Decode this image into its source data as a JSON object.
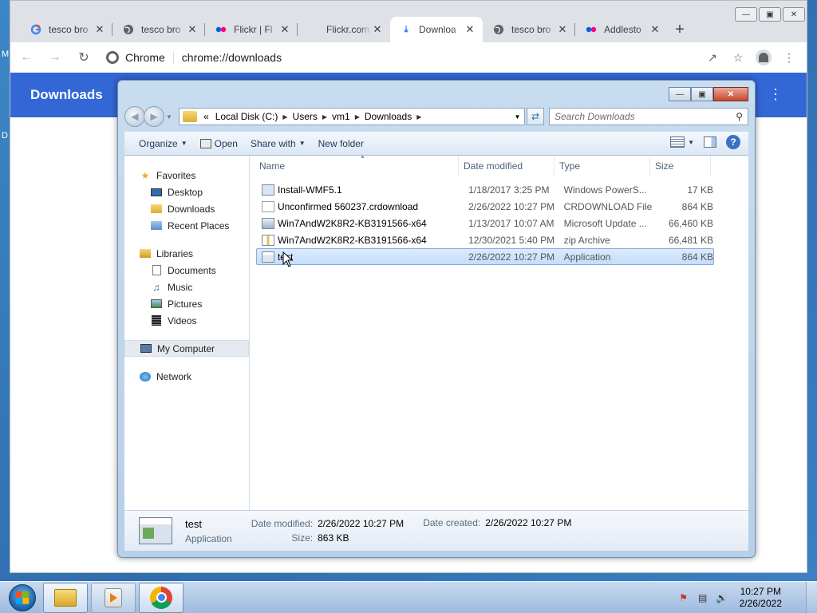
{
  "desktop": {
    "edge_texts": [
      "M",
      "D"
    ]
  },
  "browser": {
    "tabs": [
      {
        "label": "tesco bro",
        "favicon": "google-icon",
        "active": false
      },
      {
        "label": "tesco bro",
        "favicon": "globe-icon",
        "active": false
      },
      {
        "label": "Flickr | Fl",
        "favicon": "flickr-icon",
        "active": false
      },
      {
        "label": "Flickr.com",
        "favicon": "none",
        "active": false
      },
      {
        "label": "Downloa",
        "favicon": "download-icon",
        "active": true
      },
      {
        "label": "tesco bro",
        "favicon": "globe-icon",
        "active": false
      },
      {
        "label": "Addlesto",
        "favicon": "flickr-icon",
        "active": false
      }
    ],
    "omnibox": {
      "site": "Chrome",
      "url": "chrome://downloads"
    },
    "page_title": "Downloads",
    "colors": {
      "header": "#3367d6"
    }
  },
  "explorer": {
    "breadcrumb": [
      "Local Disk (C:)",
      "Users",
      "vm1",
      "Downloads"
    ],
    "breadcrumb_prefix": "«",
    "search_placeholder": "Search Downloads",
    "commands": {
      "organize": "Organize",
      "open": "Open",
      "share_with": "Share with",
      "new_folder": "New folder"
    },
    "nav": {
      "favorites": {
        "label": "Favorites",
        "items": [
          "Desktop",
          "Downloads",
          "Recent Places"
        ]
      },
      "libraries": {
        "label": "Libraries",
        "items": [
          "Documents",
          "Music",
          "Pictures",
          "Videos"
        ]
      },
      "computer": "My Computer",
      "network": "Network"
    },
    "columns": {
      "name": "Name",
      "date": "Date modified",
      "type": "Type",
      "size": "Size"
    },
    "files": [
      {
        "name": "Install-WMF5.1",
        "date": "1/18/2017 3:25 PM",
        "type": "Windows PowerS...",
        "size": "17 KB",
        "icon": "powershell-script-icon"
      },
      {
        "name": "Unconfirmed 560237.crdownload",
        "date": "2/26/2022 10:27 PM",
        "type": "CRDOWNLOAD File",
        "size": "864 KB",
        "icon": "blank-file-icon"
      },
      {
        "name": "Win7AndW2K8R2-KB3191566-x64",
        "date": "1/13/2017 10:07 AM",
        "type": "Microsoft Update ...",
        "size": "66,460 KB",
        "icon": "msu-package-icon"
      },
      {
        "name": "Win7AndW2K8R2-KB3191566-x64",
        "date": "12/30/2021 5:40 PM",
        "type": "zip Archive",
        "size": "66,481 KB",
        "icon": "zip-archive-icon"
      },
      {
        "name": "test",
        "date": "2/26/2022 10:27 PM",
        "type": "Application",
        "size": "864 KB",
        "icon": "application-icon",
        "selected": true
      }
    ],
    "details": {
      "name": "test",
      "type": "Application",
      "date_modified_label": "Date modified:",
      "date_modified": "2/26/2022 10:27 PM",
      "size_label": "Size:",
      "size": "863 KB",
      "date_created_label": "Date created:",
      "date_created": "2/26/2022 10:27 PM"
    }
  },
  "taskbar": {
    "time": "10:27 PM",
    "date": "2/26/2022"
  }
}
